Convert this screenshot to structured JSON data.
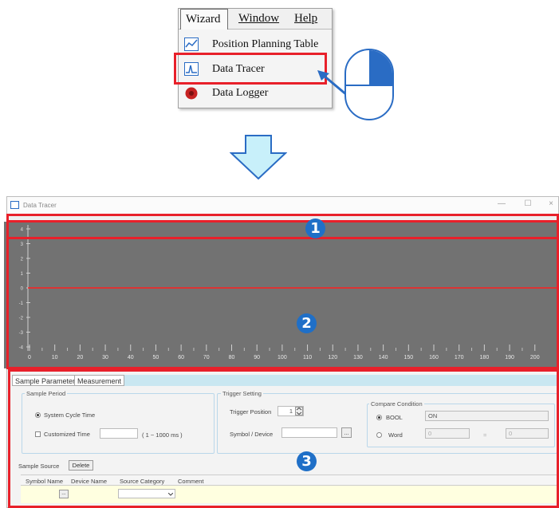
{
  "menu": {
    "bar": [
      "Wizard",
      "Window",
      "Help"
    ],
    "items": [
      {
        "label": "Position Planning Table",
        "icon": "chart-table-icon"
      },
      {
        "label": "Data Tracer",
        "icon": "data-tracer-icon"
      },
      {
        "label": "Data Logger",
        "icon": "data-logger-icon"
      }
    ]
  },
  "window": {
    "title": "Data Tracer",
    "min": "—",
    "max": "☐",
    "close": "×"
  },
  "plot": {
    "y_ticks": [
      "4",
      "3",
      "2",
      "1",
      "0",
      "-1",
      "-2",
      "-3",
      "-4"
    ],
    "x_ticks": [
      "0",
      "10",
      "20",
      "30",
      "40",
      "50",
      "60",
      "70",
      "80",
      "90",
      "100",
      "110",
      "120",
      "130",
      "140",
      "150",
      "160",
      "170",
      "180",
      "190",
      "200"
    ]
  },
  "tabs": [
    "Sample Parameter",
    "Measurement"
  ],
  "sample_period": {
    "title": "Sample Period",
    "option1": "System Cycle Time",
    "option2": "Customized Time",
    "range": "( 1 ~ 1000 ms )"
  },
  "trigger": {
    "title": "Trigger Setting",
    "position_label": "Trigger Position",
    "position_value": "1",
    "symbol_label": "Symbol / Device",
    "browse": "..."
  },
  "compare": {
    "title": "Compare Condition",
    "bool_label": "BOOL",
    "bool_value": "ON",
    "word_label": "Word",
    "word_value1": "0",
    "word_op": "=",
    "word_value2": "0"
  },
  "sample_source": {
    "label": "Sample Source",
    "delete": "Delete",
    "columns": [
      "Symbol Name",
      "Device Name",
      "Source Category",
      "Comment"
    ],
    "row_browse": "..."
  },
  "badges": [
    "1",
    "2",
    "3"
  ],
  "colors": {
    "highlight": "#e8202a",
    "accent": "#1f6fc7",
    "plot_bg": "#727272",
    "trace": "#ff2020"
  }
}
